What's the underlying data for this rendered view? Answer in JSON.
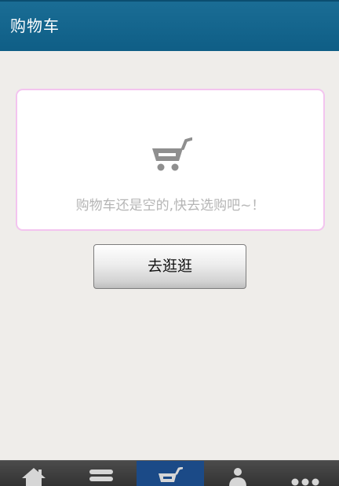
{
  "header": {
    "title": "购物车"
  },
  "cart": {
    "empty_message": "购物车还是空的,快去选购吧~！",
    "icon": "shopping-cart-icon"
  },
  "actions": {
    "go_shopping_label": "去逛逛"
  },
  "tabbar": {
    "active_index": 2,
    "items": [
      {
        "icon": "home-icon"
      },
      {
        "icon": "category-list-icon"
      },
      {
        "icon": "shopping-cart-icon"
      },
      {
        "icon": "user-icon"
      },
      {
        "icon": "more-icon"
      }
    ]
  },
  "colors": {
    "header": "#156790",
    "page_background": "#efedea",
    "card_border": "#f3c4ef",
    "tab_active": "#1b4a87"
  }
}
